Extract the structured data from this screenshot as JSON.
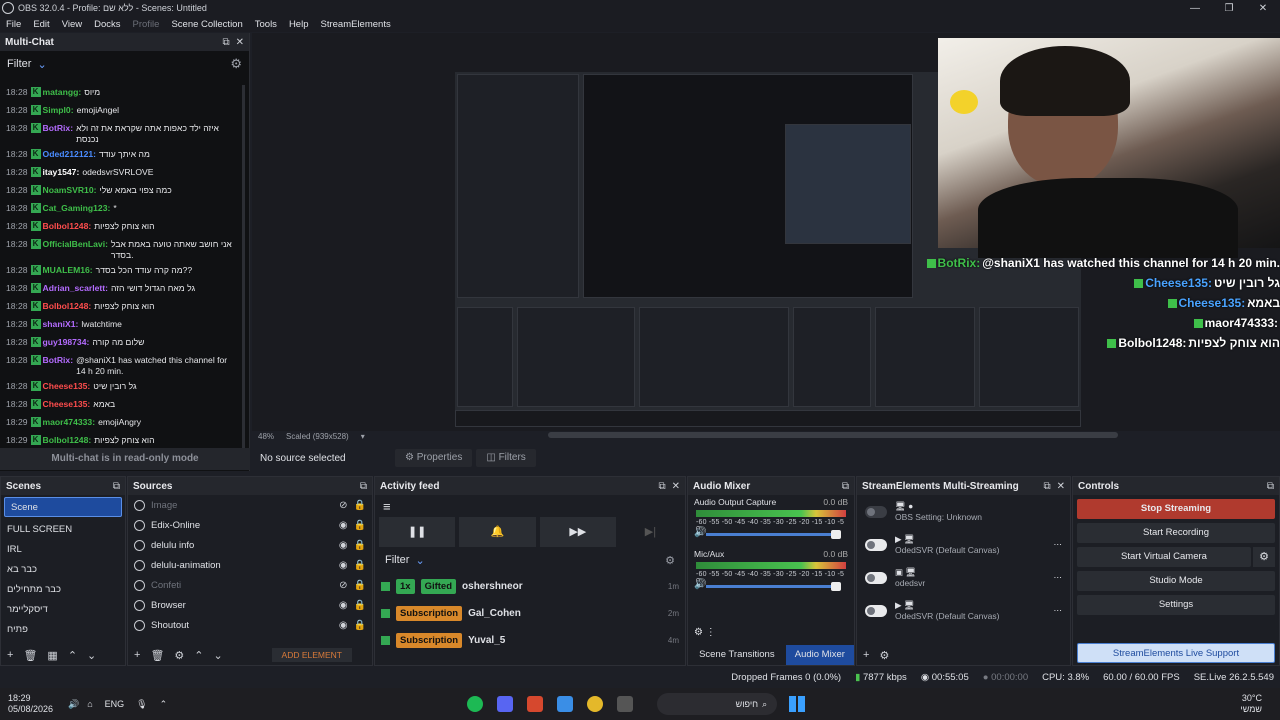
{
  "window": {
    "title": "OBS 32.0.4 - Profile: ללא שם - Scenes: Untitled"
  },
  "menu": [
    "File",
    "Edit",
    "View",
    "Docks",
    "Profile",
    "Scene Collection",
    "Tools",
    "Help",
    "StreamElements"
  ],
  "multichat": {
    "title": "Multi-Chat",
    "filter_label": "Filter",
    "readonly_text": "Multi-chat is in read-only mode",
    "messages": [
      {
        "time": "18:28",
        "user": "matangg:",
        "text": "מיוס",
        "color": "#3fbf4a"
      },
      {
        "time": "18:28",
        "user": "Simpl0:",
        "text": "emojiAngel",
        "color": "#3fbf4a"
      },
      {
        "time": "18:28",
        "user": "BotRix:",
        "text": "איזה ילד כאפות אתה שקראת את זה ולא נכנסת",
        "color": "#b46cff"
      },
      {
        "time": "18:28",
        "user": "Oded212121:",
        "text": "מה איתך עודד",
        "color": "#4a8cff"
      },
      {
        "time": "18:28",
        "user": "itay1547:",
        "text": "odedsvrSVRLOVE",
        "color": "#ffffff"
      },
      {
        "time": "18:28",
        "user": "NoamSVR10:",
        "text": "כמה צפוי באמא שלי",
        "color": "#3fbf4a"
      },
      {
        "time": "18:28",
        "user": "Cat_Gaming123:",
        "text": "*",
        "color": "#3fbf4a"
      },
      {
        "time": "18:28",
        "user": "Bolbol1248:",
        "text": "הוא צוחק לצפיות",
        "color": "#ff4d4d"
      },
      {
        "time": "18:28",
        "user": "OfficialBenLavi:",
        "text": "אני חושב שאתה טועה באמת אבל בסדר.",
        "color": "#3fbf4a"
      },
      {
        "time": "18:28",
        "user": "MUALEM16:",
        "text": "מה קרה עודד הכל בסדר??",
        "color": "#3fbf4a"
      },
      {
        "time": "18:28",
        "user": "Adrian_scarlett:",
        "text": "גל מאח הגדול דושי הזה",
        "color": "#b46cff"
      },
      {
        "time": "18:28",
        "user": "Bolbol1248:",
        "text": "הוא צוחק לצפיות",
        "color": "#ff4d4d"
      },
      {
        "time": "18:28",
        "user": "shaniX1:",
        "text": "lwatchtime",
        "color": "#b46cff"
      },
      {
        "time": "18:28",
        "user": "guy198734:",
        "text": "שלום מה קורה",
        "color": "#b46cff"
      },
      {
        "time": "18:28",
        "user": "BotRix:",
        "text": "@shaniX1 has watched this channel for 14 h 20 min.",
        "color": "#b46cff"
      },
      {
        "time": "18:28",
        "user": "Cheese135:",
        "text": "גל רובין שיט",
        "color": "#ff4d4d"
      },
      {
        "time": "18:28",
        "user": "Cheese135:",
        "text": "באמא",
        "color": "#ff4d4d"
      },
      {
        "time": "18:29",
        "user": "maor474333:",
        "text": "emojiAngry",
        "color": "#3fbf4a"
      },
      {
        "time": "18:29",
        "user": "Bolbol1248:",
        "text": "הוא צוחק לצפיות",
        "color": "#3fbf4a"
      }
    ]
  },
  "overlay_chat": [
    {
      "user": "BotRix:",
      "text": "@shaniX1 has watched this channel for 14 h 20 min.",
      "color": "#3fbf4a"
    },
    {
      "user": "Cheese135:",
      "text": "גל רובין שיט",
      "color": "#4aa3ff"
    },
    {
      "user": "Cheese135:",
      "text": "באמא",
      "color": "#4aa3ff"
    },
    {
      "user": "maor474333:",
      "text": "",
      "color": "#ffffff"
    },
    {
      "user": "Bolbol1248:",
      "text": "הוא צוחק לצפיות",
      "color": "#ffffff"
    }
  ],
  "preview": {
    "zoom": "48%",
    "scaled": "Scaled (939x528)"
  },
  "source_bar": {
    "no_source": "No source selected",
    "properties": "Properties",
    "filters": "Filters"
  },
  "scenes": {
    "title": "Scenes",
    "items": [
      "Scene",
      "FULL SCREEN",
      "IRL",
      "כבר בא",
      "כבר מתחילים",
      "דיסקליימר",
      "פתיח"
    ]
  },
  "sources": {
    "title": "Sources",
    "items": [
      {
        "name": "Image",
        "dim": true
      },
      {
        "name": "Edix-Online",
        "dim": false
      },
      {
        "name": "delulu info",
        "dim": false
      },
      {
        "name": "delulu-animation",
        "dim": false
      },
      {
        "name": "Confeti",
        "dim": true
      },
      {
        "name": "Browser",
        "dim": false
      },
      {
        "name": "Shoutout",
        "dim": false
      }
    ],
    "add_element": "ADD ELEMENT"
  },
  "activity": {
    "title": "Activity feed",
    "filter_label": "Filter",
    "rows": [
      {
        "tag": "1x",
        "tag2": "Gifted",
        "user": "oshershneor",
        "time": "1m"
      },
      {
        "tag": "Subscription",
        "tag2": "",
        "user": "Gal_Cohen",
        "time": "2m"
      },
      {
        "tag": "Subscription",
        "tag2": "",
        "user": "Yuval_5",
        "time": "4m"
      }
    ]
  },
  "mixer": {
    "title": "Audio Mixer",
    "channels": [
      {
        "name": "Audio Output Capture",
        "db": "0.0 dB"
      },
      {
        "name": "Mic/Aux",
        "db": "0.0 dB"
      }
    ],
    "scale": "-60 -55 -50 -45 -40 -35 -30 -25 -20 -15 -10 -5 0",
    "tab_transitions": "Scene Transitions",
    "tab_mixer": "Audio Mixer"
  },
  "se_multi": {
    "title": "StreamElements Multi-Streaming",
    "rows": [
      {
        "label": "OBS Setting: Unknown"
      },
      {
        "label": "OdedSVR (Default Canvas)"
      },
      {
        "label": "odedsvr"
      },
      {
        "label": "OdedSVR (Default Canvas)"
      }
    ]
  },
  "controls": {
    "title": "Controls",
    "stop_streaming": "Stop Streaming",
    "start_recording": "Start Recording",
    "start_virtual": "Start Virtual Camera",
    "studio_mode": "Studio Mode",
    "settings": "Settings",
    "live_support": "StreamElements Live Support"
  },
  "status": {
    "dropped": "Dropped Frames 0 (0.0%)",
    "kbps": "7877 kbps",
    "live_time": "00:55:05",
    "rec_time": "00:00:00",
    "cpu": "CPU: 3.8%",
    "fps": "60.00 / 60.00 FPS",
    "version": "SE.Live 26.2.5.549"
  },
  "taskbar": {
    "time": "18:29",
    "date": "05/08/2026",
    "lang": "ENG",
    "search": "חיפוש",
    "temp": "30°C",
    "weather": "שמשי"
  }
}
